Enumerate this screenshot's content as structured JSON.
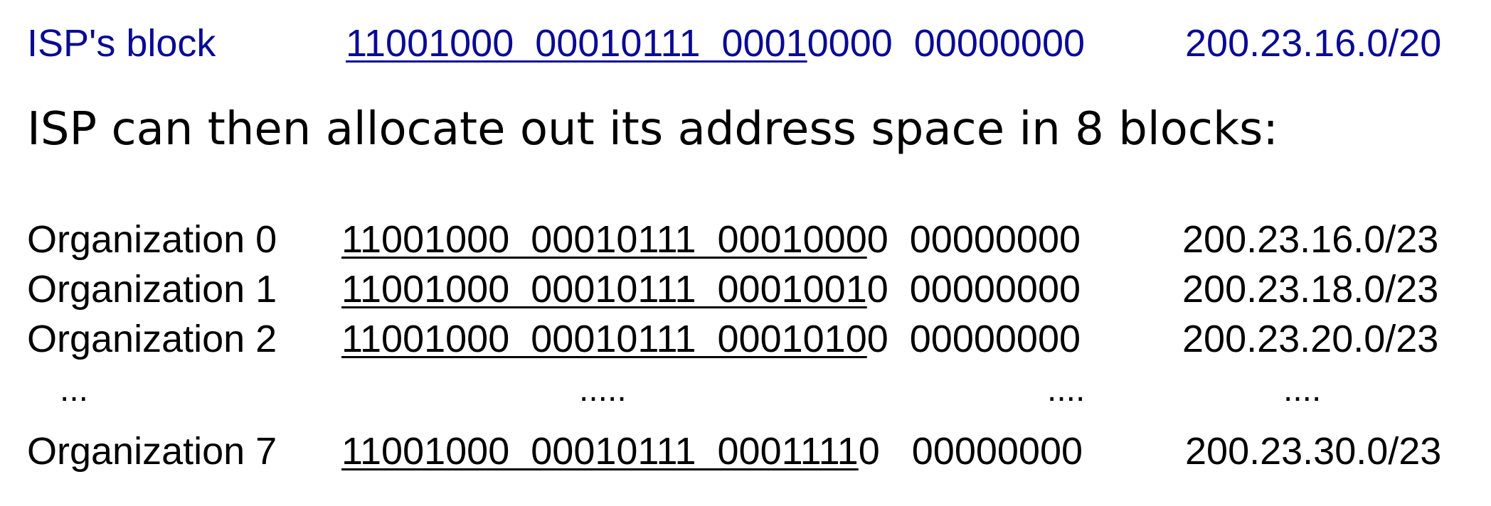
{
  "isp_block": {
    "label": "ISP's block",
    "bits_prefix": "11001000  00010111  0001",
    "bits_suffix": "0000  00000000",
    "cidr": "200.23.16.0/20"
  },
  "heading": "ISP can then allocate out its address space in 8 blocks:",
  "organizations": [
    {
      "label": "Organization 0",
      "bits_prefix": "11001000  00010111  0001000",
      "bits_suffix": "0  00000000",
      "cidr": "200.23.16.0/23"
    },
    {
      "label": "Organization 1",
      "bits_prefix": "11001000  00010111  0001001",
      "bits_suffix": "0  00000000",
      "cidr": "200.23.18.0/23"
    },
    {
      "label": "Organization 2",
      "bits_prefix": "11001000  00010111  0001010",
      "bits_suffix": "0  00000000",
      "cidr": "200.23.20.0/23"
    },
    {
      "label": "Organization 7",
      "bits_prefix": "11001000  00010111  0001111",
      "bits_suffix": "0   00000000",
      "cidr": "200.23.30.0/23"
    }
  ],
  "ellipsis": {
    "label": "...",
    "bits": ".....",
    "octet": "....",
    "cidr": "...."
  }
}
